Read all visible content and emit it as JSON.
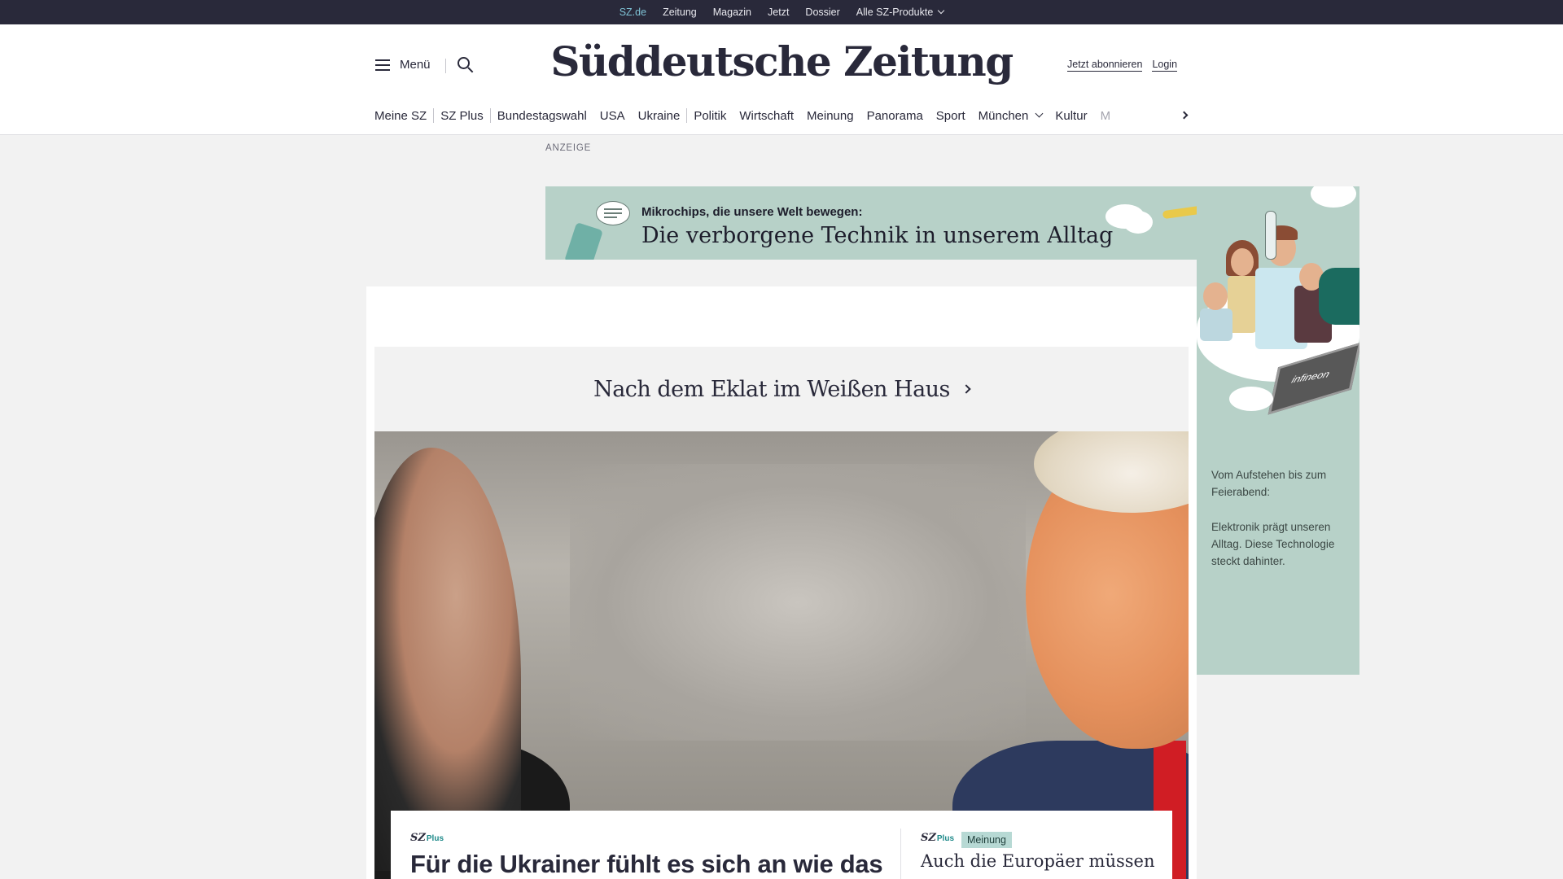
{
  "topbar": {
    "items": [
      "SZ.de",
      "Zeitung",
      "Magazin",
      "Jetzt",
      "Dossier",
      "Alle SZ-Produkte"
    ],
    "active_color": "#7fc3d6"
  },
  "header": {
    "menu_label": "Menü",
    "logo": "Süddeutsche Zeitung",
    "subscribe_label": "Jetzt abonnieren",
    "login_label": "Login"
  },
  "nav": {
    "items": [
      "Meine SZ",
      "SZ Plus",
      "Bundestagswahl",
      "USA",
      "Ukraine",
      "Politik",
      "Wirtschaft",
      "Meinung",
      "Panorama",
      "Sport",
      "München",
      "Kultur",
      "M"
    ]
  },
  "ad": {
    "label": "ANZEIGE",
    "banner_pre": "Mikrochips, die unsere Welt bewegen:",
    "banner_main": "Die verborgene Technik in unserem Alltag",
    "side_text_1": "Vom Aufstehen bis zum Feierabend:",
    "side_text_2": "Elektronik prägt unseren Alltag. Diese Technologie steckt dahinter.",
    "chip_label": "infineon",
    "bg_color": "#b7d1c8"
  },
  "topic": {
    "label": "Nach dem Eklat im Weißen Haus"
  },
  "teasers": {
    "brand_sz": "SZ",
    "brand_plus": "Plus",
    "left_headline": "Für die Ukrainer fühlt es sich an wie das",
    "right_badge": "Meinung",
    "right_headline": "Auch die Europäer müssen"
  }
}
